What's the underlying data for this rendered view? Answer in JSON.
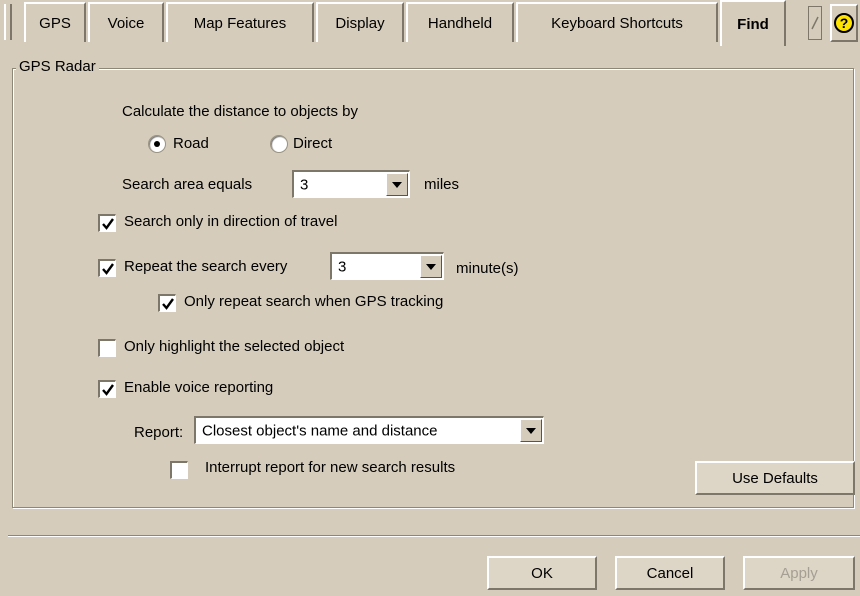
{
  "tabs": [
    {
      "label": "GPS"
    },
    {
      "label": "Voice"
    },
    {
      "label": "Map Features"
    },
    {
      "label": "Display"
    },
    {
      "label": "Handheld"
    },
    {
      "label": "Keyboard Shortcuts"
    },
    {
      "label": "Find",
      "active": true
    }
  ],
  "help_label": "?",
  "group": {
    "title": "GPS Radar"
  },
  "distance": {
    "label": "Calculate the distance to objects by",
    "options": [
      {
        "label": "Road",
        "selected": true
      },
      {
        "label": "Direct",
        "selected": false
      }
    ]
  },
  "search_area": {
    "label": "Search area equals",
    "value": "3",
    "unit": "miles"
  },
  "direction_only": {
    "label": "Search only in direction of travel",
    "checked": true
  },
  "repeat": {
    "label": "Repeat the search every",
    "value": "3",
    "unit": "minute(s)",
    "checked": true
  },
  "repeat_gps": {
    "label": "Only repeat search when GPS tracking",
    "checked": true
  },
  "highlight": {
    "label": "Only highlight the selected object",
    "checked": false
  },
  "voice": {
    "label": "Enable voice reporting",
    "checked": true
  },
  "report": {
    "label": "Report:",
    "value": "Closest object's name and distance"
  },
  "interrupt": {
    "label": "Interrupt report for new search results",
    "checked": false
  },
  "buttons": {
    "use_defaults": "Use Defaults",
    "ok": "OK",
    "cancel": "Cancel",
    "apply": "Apply"
  }
}
